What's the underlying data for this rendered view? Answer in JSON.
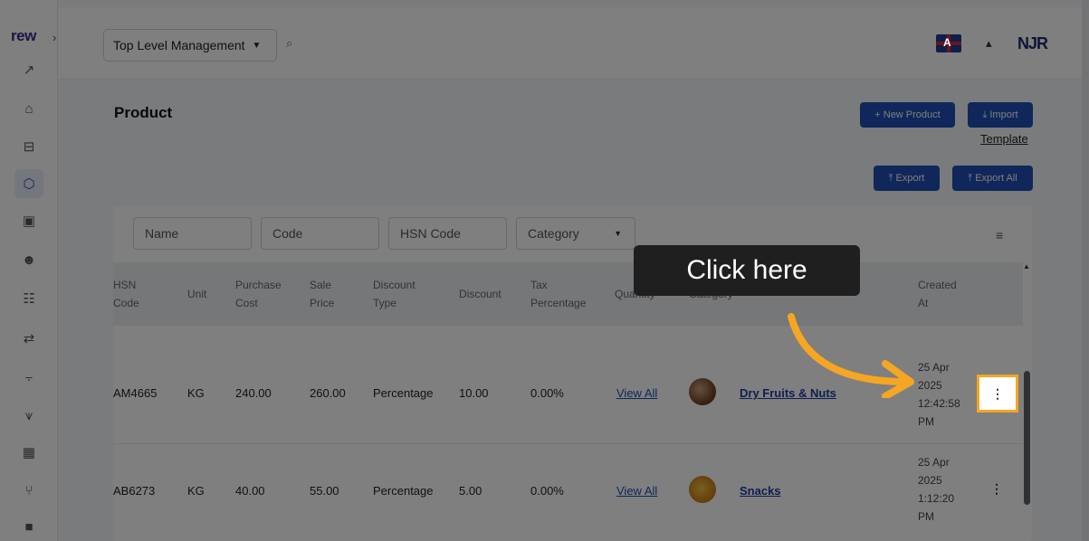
{
  "sidebar": {
    "logo": "rew",
    "expand_glyph": "›",
    "items": [
      {
        "name": "analytics-icon",
        "glyph": "↗"
      },
      {
        "name": "store-icon",
        "glyph": "⌂"
      },
      {
        "name": "hierarchy-icon",
        "glyph": "⊟"
      },
      {
        "name": "product-icon",
        "glyph": "⬡"
      },
      {
        "name": "bag-icon",
        "glyph": "▣"
      },
      {
        "name": "user-icon",
        "glyph": "☻"
      },
      {
        "name": "users-icon",
        "glyph": "☷"
      },
      {
        "name": "transfer-icon",
        "glyph": "⇄"
      },
      {
        "name": "chart-icon",
        "glyph": "⨪"
      },
      {
        "name": "funnel-icon",
        "glyph": "⩛"
      },
      {
        "name": "calculator-icon",
        "glyph": "▦"
      },
      {
        "name": "branch-icon",
        "glyph": "⑂"
      },
      {
        "name": "badge-icon",
        "glyph": "■"
      }
    ]
  },
  "topbar": {
    "org_select": "Top Level Management",
    "search_glyph": "⌕",
    "language_flag": "A",
    "bell_glyph": "▴",
    "brand": "NJR"
  },
  "page": {
    "title": "Product",
    "new_product": "+ New Product",
    "import": "⤓ Import",
    "template": "Template",
    "export": "⤒ Export",
    "export_all": "⤒ Export All"
  },
  "filters": {
    "name": "Name",
    "code": "Code",
    "hsn_code": "HSN Code",
    "category": "Category",
    "filter_glyph": "≡"
  },
  "table": {
    "headers": {
      "hsn_code": [
        "HSN",
        "Code"
      ],
      "unit": "Unit",
      "purchase_cost": [
        "Purchase",
        "Cost"
      ],
      "sale_price": [
        "Sale",
        "Price"
      ],
      "discount_type": [
        "Discount",
        "Type"
      ],
      "discount": "Discount",
      "tax_percentage": [
        "Tax",
        "Percentage"
      ],
      "quantity": "Quantity",
      "category": "Category",
      "created_at": [
        "Created",
        "At"
      ]
    },
    "rows": [
      {
        "hsn": "AM4665",
        "unit": "KG",
        "purchase": "240.00",
        "sale": "260.00",
        "discount_type": "Percentage",
        "discount": "10.00",
        "tax": "0.00%",
        "quantity": "View All",
        "category": "Dry Fruits & Nuts",
        "created": [
          "25 Apr",
          "2025",
          "12:42:58",
          "PM"
        ]
      },
      {
        "hsn": "AB6273",
        "unit": "KG",
        "purchase": "40.00",
        "sale": "55.00",
        "discount_type": "Percentage",
        "discount": "5.00",
        "tax": "0.00%",
        "quantity": "View All",
        "category": "Snacks",
        "created": [
          "25 Apr",
          "2025",
          "1:12:20",
          "PM"
        ]
      }
    ],
    "menu_glyph": "⋮"
  },
  "overlay": {
    "tooltip": "Click here",
    "accent": "#f5a623"
  }
}
